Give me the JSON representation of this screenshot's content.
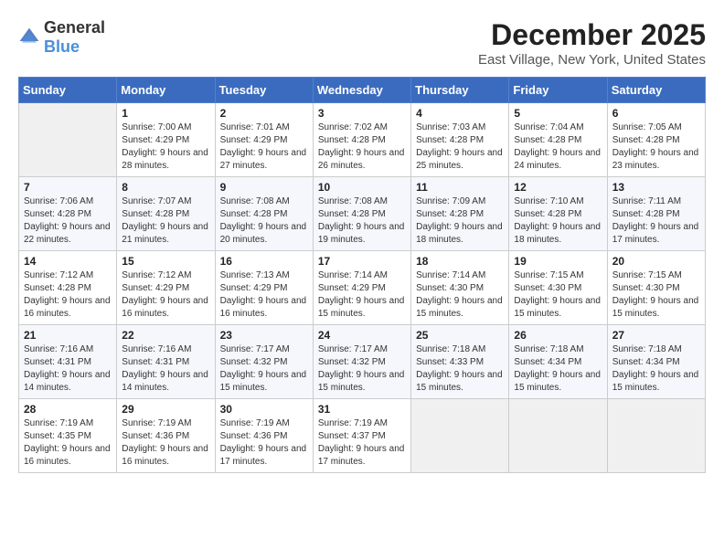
{
  "logo": {
    "text_general": "General",
    "text_blue": "Blue"
  },
  "title": "December 2025",
  "location": "East Village, New York, United States",
  "days_of_week": [
    "Sunday",
    "Monday",
    "Tuesday",
    "Wednesday",
    "Thursday",
    "Friday",
    "Saturday"
  ],
  "weeks": [
    [
      {
        "day": "",
        "sunrise": "",
        "sunset": "",
        "daylight": "",
        "empty": true
      },
      {
        "day": "1",
        "sunrise": "Sunrise: 7:00 AM",
        "sunset": "Sunset: 4:29 PM",
        "daylight": "Daylight: 9 hours and 28 minutes."
      },
      {
        "day": "2",
        "sunrise": "Sunrise: 7:01 AM",
        "sunset": "Sunset: 4:29 PM",
        "daylight": "Daylight: 9 hours and 27 minutes."
      },
      {
        "day": "3",
        "sunrise": "Sunrise: 7:02 AM",
        "sunset": "Sunset: 4:28 PM",
        "daylight": "Daylight: 9 hours and 26 minutes."
      },
      {
        "day": "4",
        "sunrise": "Sunrise: 7:03 AM",
        "sunset": "Sunset: 4:28 PM",
        "daylight": "Daylight: 9 hours and 25 minutes."
      },
      {
        "day": "5",
        "sunrise": "Sunrise: 7:04 AM",
        "sunset": "Sunset: 4:28 PM",
        "daylight": "Daylight: 9 hours and 24 minutes."
      },
      {
        "day": "6",
        "sunrise": "Sunrise: 7:05 AM",
        "sunset": "Sunset: 4:28 PM",
        "daylight": "Daylight: 9 hours and 23 minutes."
      }
    ],
    [
      {
        "day": "7",
        "sunrise": "Sunrise: 7:06 AM",
        "sunset": "Sunset: 4:28 PM",
        "daylight": "Daylight: 9 hours and 22 minutes."
      },
      {
        "day": "8",
        "sunrise": "Sunrise: 7:07 AM",
        "sunset": "Sunset: 4:28 PM",
        "daylight": "Daylight: 9 hours and 21 minutes."
      },
      {
        "day": "9",
        "sunrise": "Sunrise: 7:08 AM",
        "sunset": "Sunset: 4:28 PM",
        "daylight": "Daylight: 9 hours and 20 minutes."
      },
      {
        "day": "10",
        "sunrise": "Sunrise: 7:08 AM",
        "sunset": "Sunset: 4:28 PM",
        "daylight": "Daylight: 9 hours and 19 minutes."
      },
      {
        "day": "11",
        "sunrise": "Sunrise: 7:09 AM",
        "sunset": "Sunset: 4:28 PM",
        "daylight": "Daylight: 9 hours and 18 minutes."
      },
      {
        "day": "12",
        "sunrise": "Sunrise: 7:10 AM",
        "sunset": "Sunset: 4:28 PM",
        "daylight": "Daylight: 9 hours and 18 minutes."
      },
      {
        "day": "13",
        "sunrise": "Sunrise: 7:11 AM",
        "sunset": "Sunset: 4:28 PM",
        "daylight": "Daylight: 9 hours and 17 minutes."
      }
    ],
    [
      {
        "day": "14",
        "sunrise": "Sunrise: 7:12 AM",
        "sunset": "Sunset: 4:28 PM",
        "daylight": "Daylight: 9 hours and 16 minutes."
      },
      {
        "day": "15",
        "sunrise": "Sunrise: 7:12 AM",
        "sunset": "Sunset: 4:29 PM",
        "daylight": "Daylight: 9 hours and 16 minutes."
      },
      {
        "day": "16",
        "sunrise": "Sunrise: 7:13 AM",
        "sunset": "Sunset: 4:29 PM",
        "daylight": "Daylight: 9 hours and 16 minutes."
      },
      {
        "day": "17",
        "sunrise": "Sunrise: 7:14 AM",
        "sunset": "Sunset: 4:29 PM",
        "daylight": "Daylight: 9 hours and 15 minutes."
      },
      {
        "day": "18",
        "sunrise": "Sunrise: 7:14 AM",
        "sunset": "Sunset: 4:30 PM",
        "daylight": "Daylight: 9 hours and 15 minutes."
      },
      {
        "day": "19",
        "sunrise": "Sunrise: 7:15 AM",
        "sunset": "Sunset: 4:30 PM",
        "daylight": "Daylight: 9 hours and 15 minutes."
      },
      {
        "day": "20",
        "sunrise": "Sunrise: 7:15 AM",
        "sunset": "Sunset: 4:30 PM",
        "daylight": "Daylight: 9 hours and 15 minutes."
      }
    ],
    [
      {
        "day": "21",
        "sunrise": "Sunrise: 7:16 AM",
        "sunset": "Sunset: 4:31 PM",
        "daylight": "Daylight: 9 hours and 14 minutes."
      },
      {
        "day": "22",
        "sunrise": "Sunrise: 7:16 AM",
        "sunset": "Sunset: 4:31 PM",
        "daylight": "Daylight: 9 hours and 14 minutes."
      },
      {
        "day": "23",
        "sunrise": "Sunrise: 7:17 AM",
        "sunset": "Sunset: 4:32 PM",
        "daylight": "Daylight: 9 hours and 15 minutes."
      },
      {
        "day": "24",
        "sunrise": "Sunrise: 7:17 AM",
        "sunset": "Sunset: 4:32 PM",
        "daylight": "Daylight: 9 hours and 15 minutes."
      },
      {
        "day": "25",
        "sunrise": "Sunrise: 7:18 AM",
        "sunset": "Sunset: 4:33 PM",
        "daylight": "Daylight: 9 hours and 15 minutes."
      },
      {
        "day": "26",
        "sunrise": "Sunrise: 7:18 AM",
        "sunset": "Sunset: 4:34 PM",
        "daylight": "Daylight: 9 hours and 15 minutes."
      },
      {
        "day": "27",
        "sunrise": "Sunrise: 7:18 AM",
        "sunset": "Sunset: 4:34 PM",
        "daylight": "Daylight: 9 hours and 15 minutes."
      }
    ],
    [
      {
        "day": "28",
        "sunrise": "Sunrise: 7:19 AM",
        "sunset": "Sunset: 4:35 PM",
        "daylight": "Daylight: 9 hours and 16 minutes."
      },
      {
        "day": "29",
        "sunrise": "Sunrise: 7:19 AM",
        "sunset": "Sunset: 4:36 PM",
        "daylight": "Daylight: 9 hours and 16 minutes."
      },
      {
        "day": "30",
        "sunrise": "Sunrise: 7:19 AM",
        "sunset": "Sunset: 4:36 PM",
        "daylight": "Daylight: 9 hours and 17 minutes."
      },
      {
        "day": "31",
        "sunrise": "Sunrise: 7:19 AM",
        "sunset": "Sunset: 4:37 PM",
        "daylight": "Daylight: 9 hours and 17 minutes."
      },
      {
        "day": "",
        "sunrise": "",
        "sunset": "",
        "daylight": "",
        "empty": true
      },
      {
        "day": "",
        "sunrise": "",
        "sunset": "",
        "daylight": "",
        "empty": true
      },
      {
        "day": "",
        "sunrise": "",
        "sunset": "",
        "daylight": "",
        "empty": true
      }
    ]
  ]
}
